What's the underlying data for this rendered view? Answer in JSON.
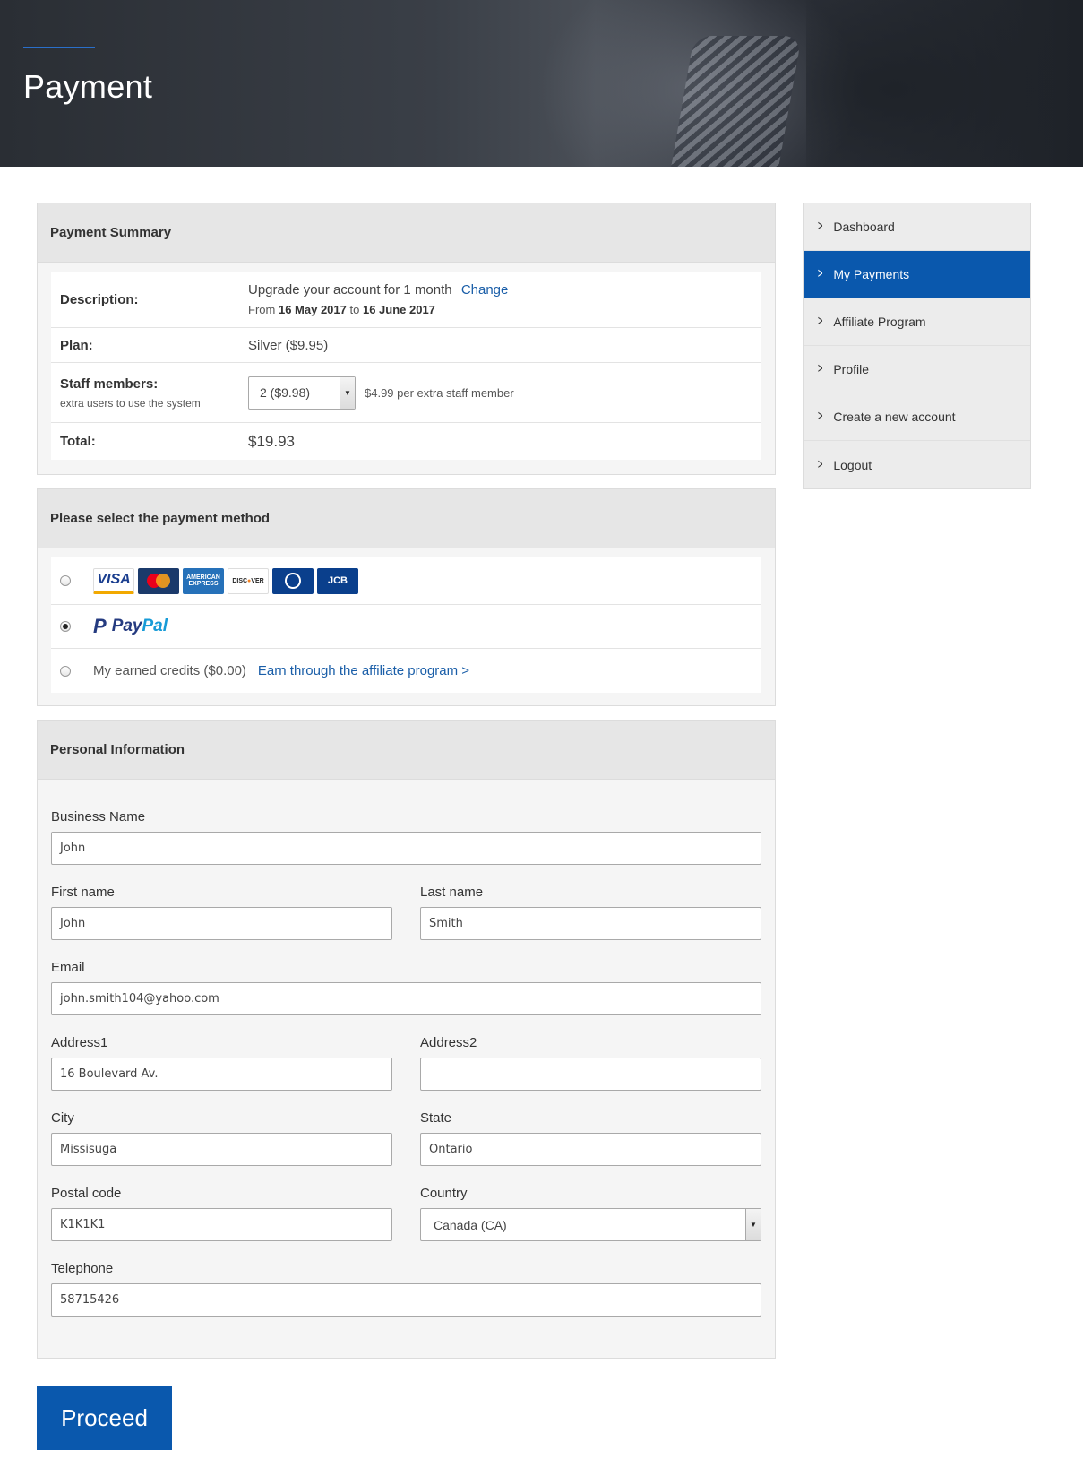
{
  "hero": {
    "title": "Payment"
  },
  "summary": {
    "title": "Payment Summary",
    "description_label": "Description:",
    "description_text": "Upgrade your account for 1 month",
    "change_link": "Change",
    "from_word": "From",
    "date_from": "16 May 2017",
    "to_word": "to",
    "date_to": "16 June 2017",
    "plan_label": "Plan:",
    "plan_value": "Silver ($9.95)",
    "staff_label": "Staff members:",
    "staff_sub": "extra users to use the system",
    "staff_selected": "2 ($9.98)",
    "staff_note": "$4.99 per extra staff member",
    "total_label": "Total:",
    "total_value": "$19.93"
  },
  "payment_method": {
    "title": "Please select the payment method",
    "cards": [
      "VISA",
      "MasterCard",
      "AMERICAN EXPRESS",
      "DISCOVER",
      "Diners Club",
      "JCB"
    ],
    "paypal_pay": "Pay",
    "paypal_pal": "Pal",
    "credits_label": "My earned credits ($0.00)",
    "credits_link": "Earn through the affiliate program >",
    "selected": "paypal"
  },
  "personal": {
    "title": "Personal Information",
    "business_name_label": "Business Name",
    "business_name": "John",
    "first_name_label": "First name",
    "first_name": "John",
    "last_name_label": "Last name",
    "last_name": "Smith",
    "email_label": "Email",
    "email": "john.smith104@yahoo.com",
    "address1_label": "Address1",
    "address1": "16 Boulevard Av.",
    "address2_label": "Address2",
    "address2": "",
    "city_label": "City",
    "city": "Missisuga",
    "state_label": "State",
    "state": "Ontario",
    "postal_label": "Postal code",
    "postal": "K1K1K1",
    "country_label": "Country",
    "country": "Canada (CA)",
    "telephone_label": "Telephone",
    "telephone": "58715426"
  },
  "sidebar": {
    "items": [
      {
        "label": "Dashboard"
      },
      {
        "label": "My Payments"
      },
      {
        "label": "Affiliate Program"
      },
      {
        "label": "Profile"
      },
      {
        "label": "Create a new account"
      },
      {
        "label": "Logout"
      }
    ],
    "active_index": 1
  },
  "proceed_label": "Proceed",
  "colors": {
    "primary": "#0a58ad",
    "link": "#1a5ea8",
    "panel_head": "#e6e6e6"
  }
}
